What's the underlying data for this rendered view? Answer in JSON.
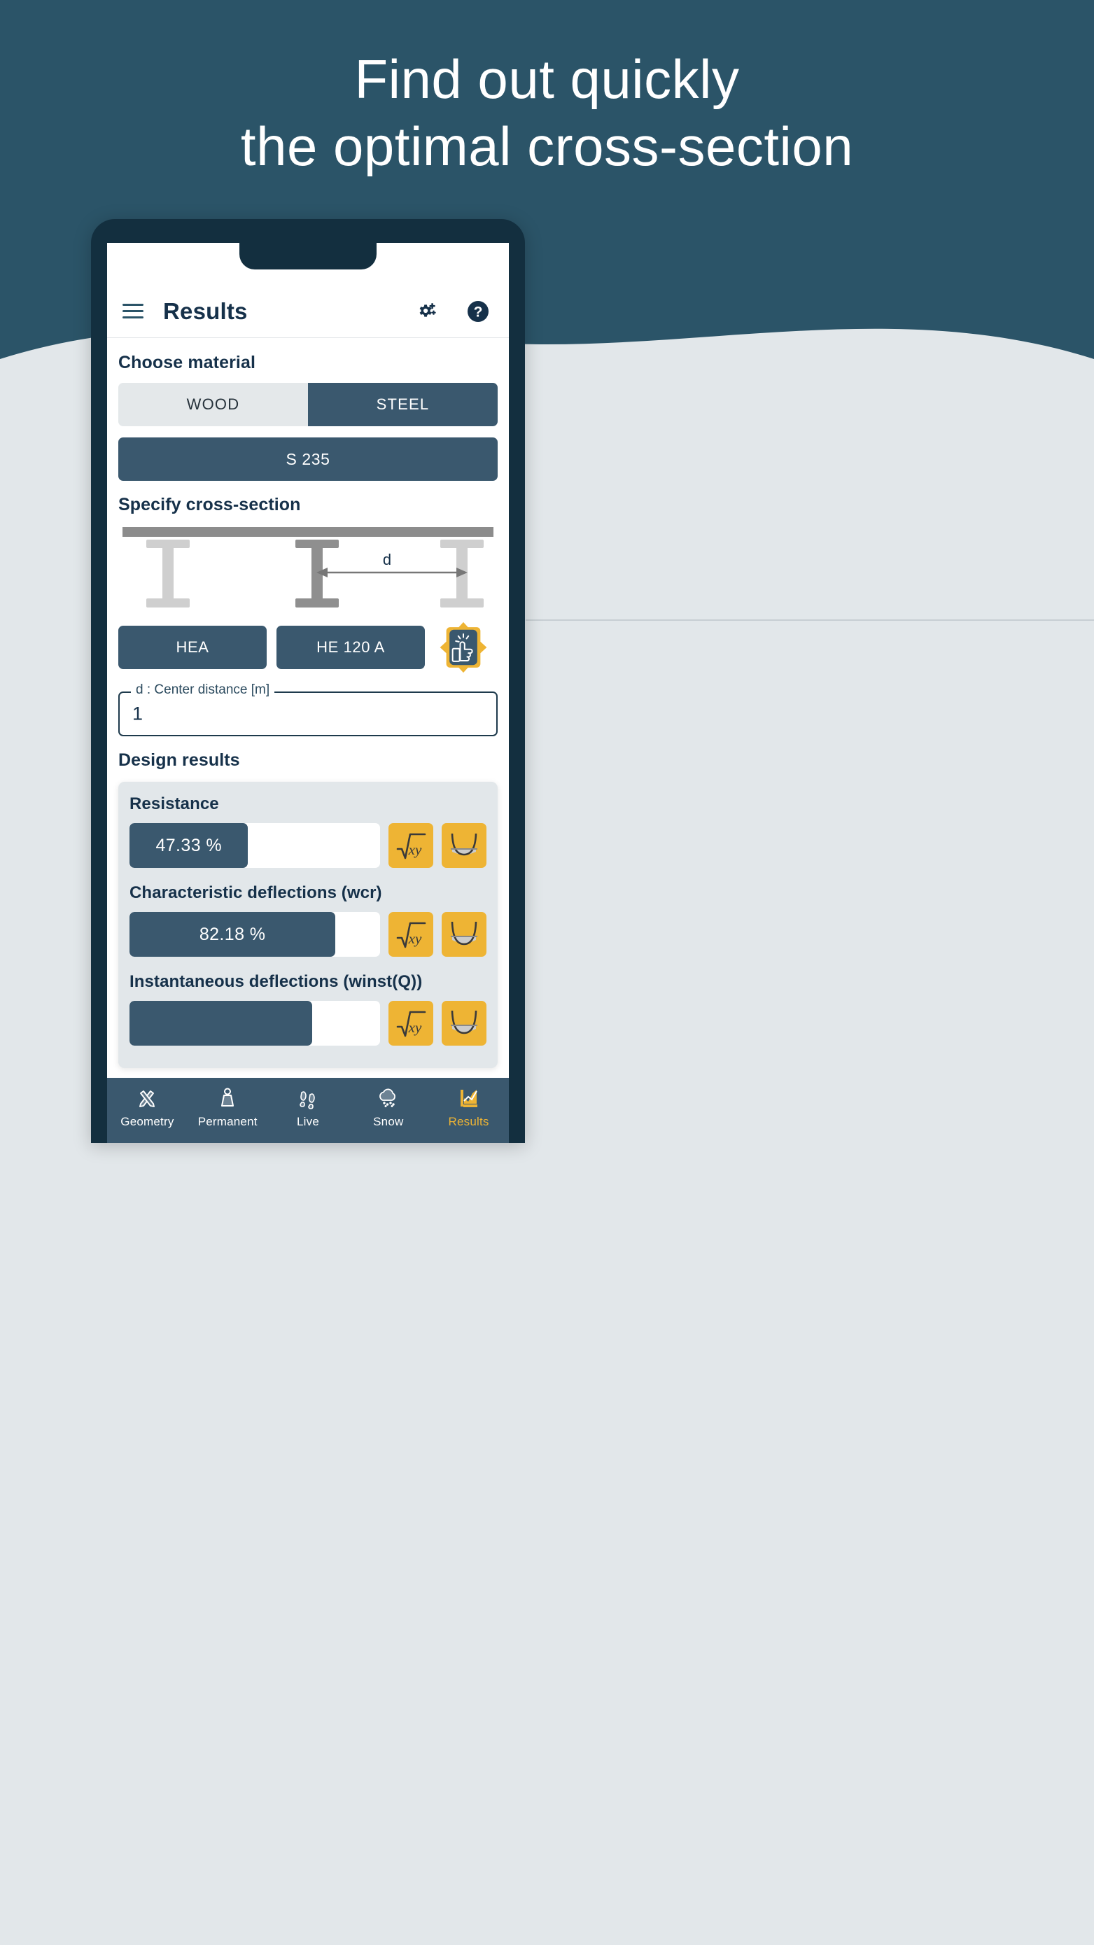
{
  "promo": {
    "line1": "Find out quickly",
    "line2": "the optimal cross-section"
  },
  "colors": {
    "brand_dark": "#2b5468",
    "panel_light": "#e2e7ea",
    "phone_frame": "#132f3f",
    "accent_yellow": "#eeb434",
    "button_blue": "#3a586e",
    "text_dark": "#16314a"
  },
  "appbar": {
    "title": "Results",
    "menu_icon": "hamburger-menu-icon",
    "settings_icon": "gear-plus-icon",
    "help_icon": "help-circle-icon"
  },
  "material": {
    "section_title": "Choose material",
    "options": [
      {
        "label": "WOOD",
        "selected": false
      },
      {
        "label": "STEEL",
        "selected": true
      }
    ],
    "grade_button": "S 235"
  },
  "cross_section": {
    "section_title": "Specify cross-section",
    "dimension_label": "d",
    "profile_family": "HEA",
    "profile_size": "HE 120 A",
    "suggest_badge_icon": "thumbs-up-badge-icon",
    "field_label": "d : Center distance [m]",
    "field_value": "1",
    "field_placeholder": "1"
  },
  "design_results": {
    "section_title": "Design results",
    "rows": [
      {
        "label": "Resistance",
        "value": "47.33 %",
        "percent": 47.33,
        "formula_icon": "sqrt-xy-icon",
        "chart_icon": "deflection-curve-icon"
      },
      {
        "label": "Characteristic deflections (wcr)",
        "value": "82.18 %",
        "percent": 82.18,
        "formula_icon": "sqrt-xy-icon",
        "chart_icon": "deflection-curve-icon"
      },
      {
        "label": "Instantaneous deflections (winst(Q))",
        "value": "",
        "percent": 73,
        "formula_icon": "sqrt-xy-icon",
        "chart_icon": "deflection-curve-icon"
      }
    ]
  },
  "bottom_nav": {
    "items": [
      {
        "label": "Geometry",
        "icon": "ruler-pencil-icon",
        "active": false
      },
      {
        "label": "Permanent",
        "icon": "weight-icon",
        "active": false
      },
      {
        "label": "Live",
        "icon": "footprints-icon",
        "active": false
      },
      {
        "label": "Snow",
        "icon": "snow-cloud-icon",
        "active": false
      },
      {
        "label": "Results",
        "icon": "chart-results-icon",
        "active": true
      }
    ]
  }
}
